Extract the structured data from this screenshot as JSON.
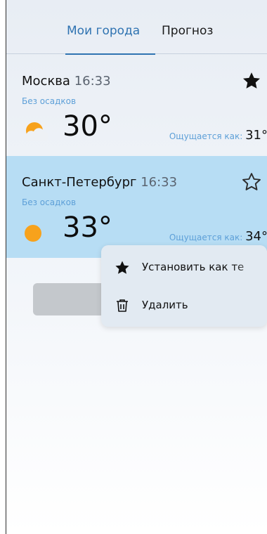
{
  "tabs": [
    {
      "label": "Мои города",
      "active": true
    },
    {
      "label": "Прогноз",
      "active": false
    }
  ],
  "cities": [
    {
      "name": "Москва",
      "time": "16:33",
      "precipitation": "Без осадков",
      "temperature": "30°",
      "feels_like_label": "Ощущается как:",
      "feels_like_value": "31°",
      "weather_icon": "partly-cloudy-icon",
      "is_current": true,
      "star_icon": "star-filled-icon"
    },
    {
      "name": "Санкт-Петербург",
      "time": "16:33",
      "precipitation": "Без осадков",
      "temperature": "33°",
      "feels_like_label": "Ощущается как:",
      "feels_like_value": "34°",
      "weather_icon": "sun-icon",
      "is_current": false,
      "star_icon": "star-outline-icon",
      "selected": true
    }
  ],
  "context_menu": {
    "items": [
      {
        "label": "Установить как те",
        "icon": "star-filled-icon"
      },
      {
        "label": "Удалить",
        "icon": "trash-icon"
      }
    ]
  },
  "colors": {
    "accent": "#2f73b1",
    "precip_text": "#5ea0d8",
    "selected_card": "#b7ddf4",
    "menu_bg": "#e2eaf2",
    "sun": "#f7a21c",
    "button_gray": "#c4c8cc"
  }
}
